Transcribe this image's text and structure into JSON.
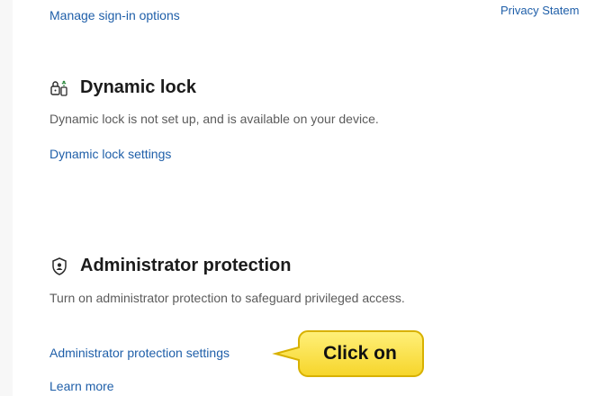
{
  "top": {
    "manage_signin_link": "Manage sign-in options",
    "privacy_link": "Privacy Statem"
  },
  "dynamic_lock": {
    "title": "Dynamic lock",
    "icon": "dynamic-lock-icon",
    "description": "Dynamic lock is not set up, and is available on your device.",
    "settings_link": "Dynamic lock settings"
  },
  "admin_protection": {
    "title": "Administrator protection",
    "icon": "admin-shield-icon",
    "description": "Turn on administrator protection to safeguard privileged access.",
    "settings_link": "Administrator protection settings",
    "learn_more_link": "Learn more"
  },
  "callout": {
    "text": "Click on",
    "fill_color": "#fbe24a",
    "border_color": "#d8b100"
  },
  "colors": {
    "link": "#1f5fa9",
    "text_secondary": "#5b5b5b"
  }
}
